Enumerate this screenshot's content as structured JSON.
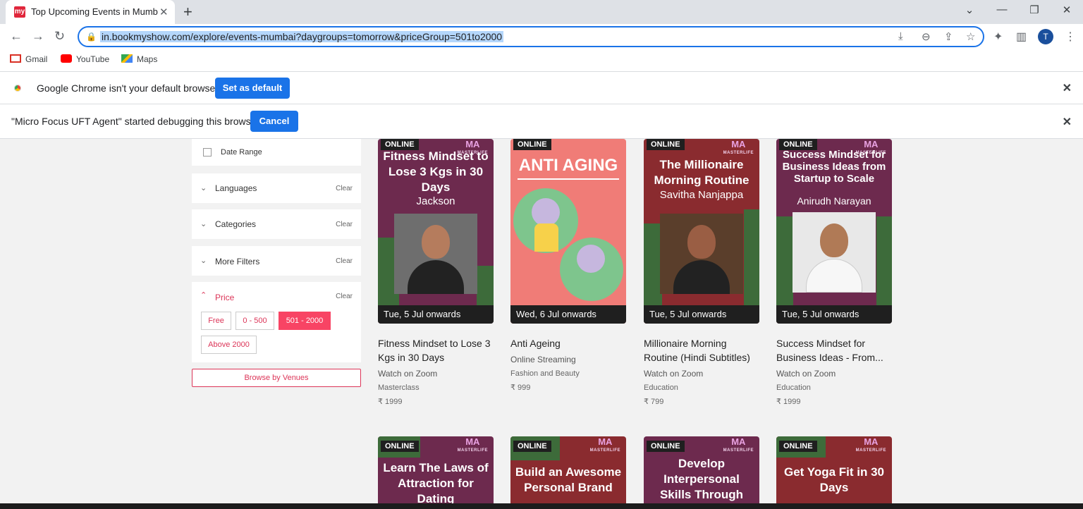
{
  "browser": {
    "tab_title": "Top Upcoming Events in Mumba",
    "favicon_text": "my",
    "url": "in.bookmyshow.com/explore/events-mumbai?daygroups=tomorrow&priceGroup=501to2000",
    "avatar_letter": "T",
    "accent": "#1a73e8"
  },
  "bookmarks": [
    {
      "label": "Gmail",
      "icon": "gmail-icon"
    },
    {
      "label": "YouTube",
      "icon": "youtube-icon"
    },
    {
      "label": "Maps",
      "icon": "maps-icon"
    }
  ],
  "infobars": {
    "default_msg": "Google Chrome isn't your default browser",
    "default_btn": "Set as default",
    "debug_msg": "\"Micro Focus UFT Agent\" started debugging this browser",
    "debug_btn": "Cancel"
  },
  "filters": {
    "date_range": "Date Range",
    "languages": "Languages",
    "categories": "Categories",
    "more_filters": "More Filters",
    "price": "Price",
    "clear": "Clear",
    "price_options": [
      "Free",
      "0 - 500",
      "501 - 2000",
      "Above 2000"
    ],
    "selected_price": "501 - 2000",
    "browse_venues": "Browse by Venues"
  },
  "events": [
    {
      "poster_title": "Fitness Mindset to Lose 3 Kgs in 30 Days",
      "poster_sub": "Jackson",
      "date": "Tue, 5 Jul onwards",
      "name": "Fitness Mindset to Lose 3 Kgs in 30 Days",
      "venue": "Watch on Zoom",
      "category": "Masterclass",
      "price": "₹ 1999",
      "online": "ONLINE"
    },
    {
      "poster_title": "ANTI AGING",
      "poster_sub": "",
      "date": "Wed, 6 Jul onwards",
      "name": "Anti Ageing",
      "venue": "Online Streaming",
      "category": "Fashion and Beauty",
      "price": "₹ 999",
      "online": "ONLINE"
    },
    {
      "poster_title": "The Millionaire Morning Routine",
      "poster_sub": "Savitha Nanjappa",
      "date": "Tue, 5 Jul onwards",
      "name": "Millionaire Morning Routine (Hindi Subtitles)",
      "venue": "Watch on Zoom",
      "category": "Education",
      "price": "₹ 799",
      "online": "ONLINE"
    },
    {
      "poster_title": "Success Mindset for Business Ideas from Startup to Scale",
      "poster_sub": "Anirudh Narayan",
      "date": "Tue, 5 Jul onwards",
      "name": "Success Mindset for Business Ideas - From...",
      "venue": "Watch on Zoom",
      "category": "Education",
      "price": "₹ 1999",
      "online": "ONLINE"
    }
  ],
  "events_row2": [
    {
      "poster_title": "Learn The Laws of Attraction for Dating",
      "online": "ONLINE"
    },
    {
      "poster_title": "Build an Awesome Personal Brand",
      "online": "ONLINE"
    },
    {
      "poster_title": "Develop Interpersonal Skills Through Magic",
      "online": "ONLINE"
    },
    {
      "poster_title": "Get Yoga Fit in 30 Days",
      "online": "ONLINE"
    }
  ],
  "brand": {
    "logo": "MA",
    "caption": "MASTERLIFE"
  }
}
